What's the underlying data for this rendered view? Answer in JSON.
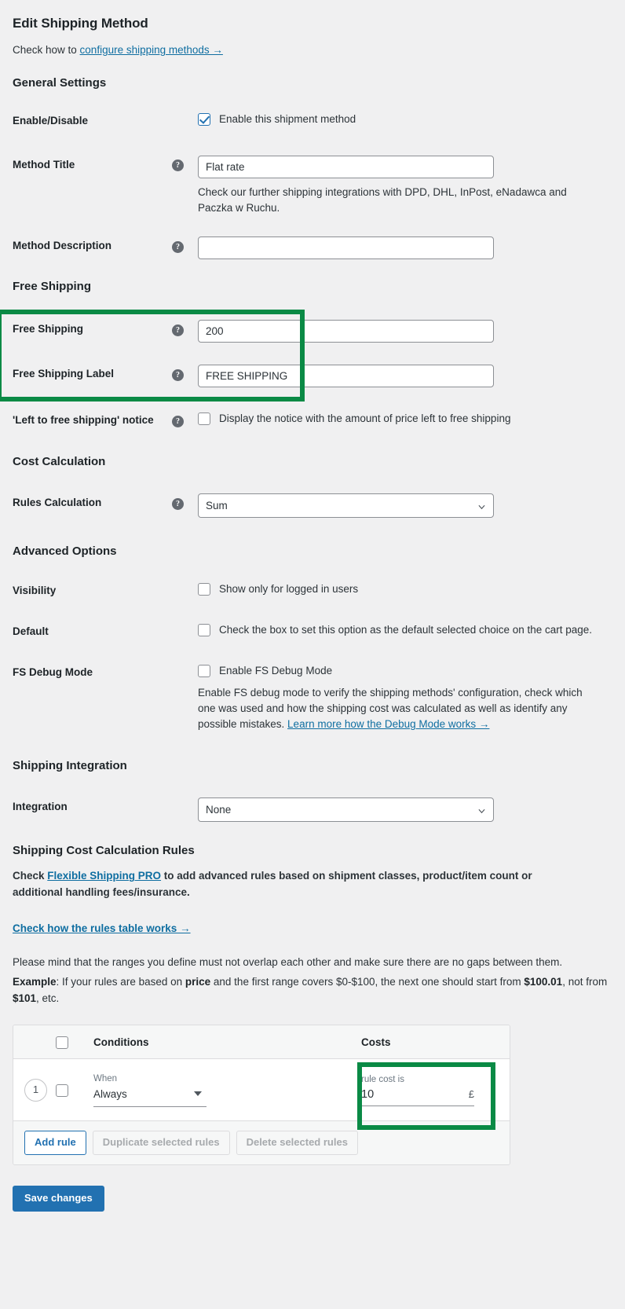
{
  "header": {
    "title": "Edit Shipping Method",
    "subtitle_prefix": "Check how to ",
    "subtitle_link": "configure shipping methods →"
  },
  "sections": {
    "general": "General Settings",
    "free_shipping": "Free Shipping",
    "cost_calculation": "Cost Calculation",
    "advanced_options": "Advanced Options",
    "shipping_integration": "Shipping Integration",
    "rules": "Shipping Cost Calculation Rules"
  },
  "fields": {
    "enable_disable": {
      "label": "Enable/Disable",
      "checkbox_text": "Enable this shipment method",
      "checked": true
    },
    "method_title": {
      "label": "Method Title",
      "value": "Flat rate",
      "description": "Check our further shipping integrations with DPD, DHL, InPost, eNadawca and Paczka w Ruchu."
    },
    "method_description": {
      "label": "Method Description",
      "value": ""
    },
    "free_shipping": {
      "label": "Free Shipping",
      "value": "200"
    },
    "free_shipping_label": {
      "label": "Free Shipping Label",
      "value": "FREE SHIPPING"
    },
    "left_to_free_notice": {
      "label": "'Left to free shipping' notice",
      "checkbox_text": "Display the notice with the amount of price left to free shipping",
      "checked": false
    },
    "rules_calculation": {
      "label": "Rules Calculation",
      "value": "Sum",
      "options": [
        "Sum"
      ]
    },
    "visibility": {
      "label": "Visibility",
      "checkbox_text": "Show only for logged in users",
      "checked": false
    },
    "default": {
      "label": "Default",
      "checkbox_text": "Check the box to set this option as the default selected choice on the cart page.",
      "checked": false
    },
    "fs_debug_mode": {
      "label": "FS Debug Mode",
      "checkbox_text": "Enable FS Debug Mode",
      "checked": false,
      "description_text": "Enable FS debug mode to verify the shipping methods' configuration, check which one was used and how the shipping cost was calculated as well as identify any possible mistakes. ",
      "description_link": "Learn more how the Debug Mode works →"
    },
    "integration": {
      "label": "Integration",
      "value": "None",
      "options": [
        "None"
      ]
    }
  },
  "rules_intro": {
    "check_prefix": "Check ",
    "pro_link": "Flexible Shipping PRO",
    "check_suffix": " to add advanced rules based on shipment classes, product/item count or additional handling fees/insurance.",
    "table_works_link": "Check how the rules table works →",
    "mind_text": "Please mind that the ranges you define must not overlap each other and make sure there are no gaps between them.",
    "example_label": "Example",
    "example_part1": ": If your rules are based on ",
    "example_bold1": "price",
    "example_part2": " and the first range covers $0-$100, the next one should start from ",
    "example_bold2": "$100.01",
    "example_part3": ", not from ",
    "example_bold3": "$101",
    "example_part4": ", etc."
  },
  "rules_table": {
    "headers": {
      "conditions": "Conditions",
      "costs": "Costs"
    },
    "rows": [
      {
        "number": "1",
        "when_label": "When",
        "when_value": "Always",
        "cost_label": "rule cost is",
        "cost_value": "10",
        "currency": "£"
      }
    ],
    "footer_buttons": {
      "add_rule": "Add rule",
      "duplicate": "Duplicate selected rules",
      "delete": "Delete selected rules"
    }
  },
  "footer": {
    "save_label": "Save changes"
  },
  "colors": {
    "highlight_green": "#0a8a45",
    "link_blue": "#0f6ea1",
    "primary_blue": "#2271b1",
    "page_bg": "#f0f0f1"
  }
}
